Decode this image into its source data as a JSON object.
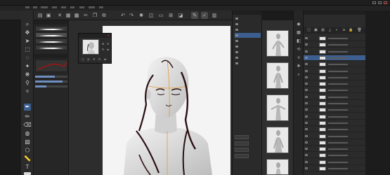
{
  "app": {
    "title": "Clip Studio Paint"
  },
  "menu": {
    "items": [
      "File",
      "Edit",
      "Animation",
      "Layer",
      "Select",
      "View",
      "Filter",
      "Window",
      "Help"
    ]
  },
  "toolbar": {
    "icons": [
      "new-icon",
      "open-icon",
      "save-icon",
      "undo-icon",
      "redo-icon",
      "clear-icon",
      "transform-icon",
      "fill-icon",
      "snap-icon",
      "ruler-icon",
      "pen-icon",
      "settings-icon"
    ]
  },
  "tools": {
    "icons": [
      "zoom-icon",
      "move-icon",
      "operation-icon",
      "selection-icon",
      "lasso-icon",
      "eyedropper-icon",
      "pen-icon",
      "pencil-icon",
      "brush-icon",
      "airbrush-icon",
      "eraser-icon",
      "fill-icon",
      "gradient-icon",
      "figure-icon",
      "text-icon",
      "ruler-icon"
    ],
    "selected_index": 6
  },
  "subtool": {
    "strokes": 4,
    "selected_stroke": 1
  },
  "navigator": {},
  "material": {
    "items": 9,
    "selected_index": 3,
    "buttons": 4
  },
  "poses": {
    "count": 5
  },
  "layers": {
    "rows": 21,
    "selected_index": 3
  },
  "colors": {
    "accent": "#3d5f8f",
    "canvas": "#f4f4f4",
    "panel": "#2b2b2b",
    "line_art": "#2a0f12",
    "guide_line": "#e29a3c"
  }
}
